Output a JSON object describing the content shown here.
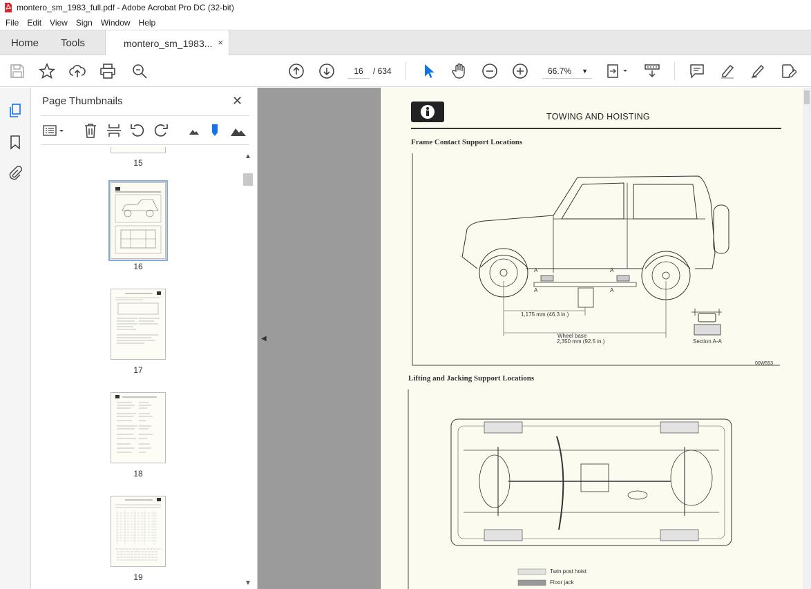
{
  "window": {
    "title": "montero_sm_1983_full.pdf - Adobe Acrobat Pro DC (32-bit)"
  },
  "menu": [
    "File",
    "Edit",
    "View",
    "Sign",
    "Window",
    "Help"
  ],
  "tabs": {
    "home": "Home",
    "tools": "Tools",
    "document": "montero_sm_1983...",
    "close": "×"
  },
  "toolbar": {
    "current_page": "16",
    "page_total": "/ 634",
    "zoom": "66.7%"
  },
  "panel": {
    "title": "Page Thumbnails",
    "close": "✕",
    "thumbnails": [
      {
        "label": "15"
      },
      {
        "label": "16",
        "selected": true
      },
      {
        "label": "17"
      },
      {
        "label": "18"
      },
      {
        "label": "19"
      }
    ]
  },
  "page": {
    "header": "TOWING AND HOISTING",
    "section1": "Frame Contact Support Locations",
    "section2": "Lifting and Jacking Support Locations",
    "dim1": "1,175 mm (46.3 in.)",
    "wheelbase_label": "Wheel base",
    "wheelbase_value": "2,350 mm (92.5 in.)",
    "section_aa": "Section A-A",
    "figure_code": "00W553",
    "marker_a": "A",
    "legend_twin": "Twin post hoist",
    "legend_floor": "Floor jack"
  }
}
